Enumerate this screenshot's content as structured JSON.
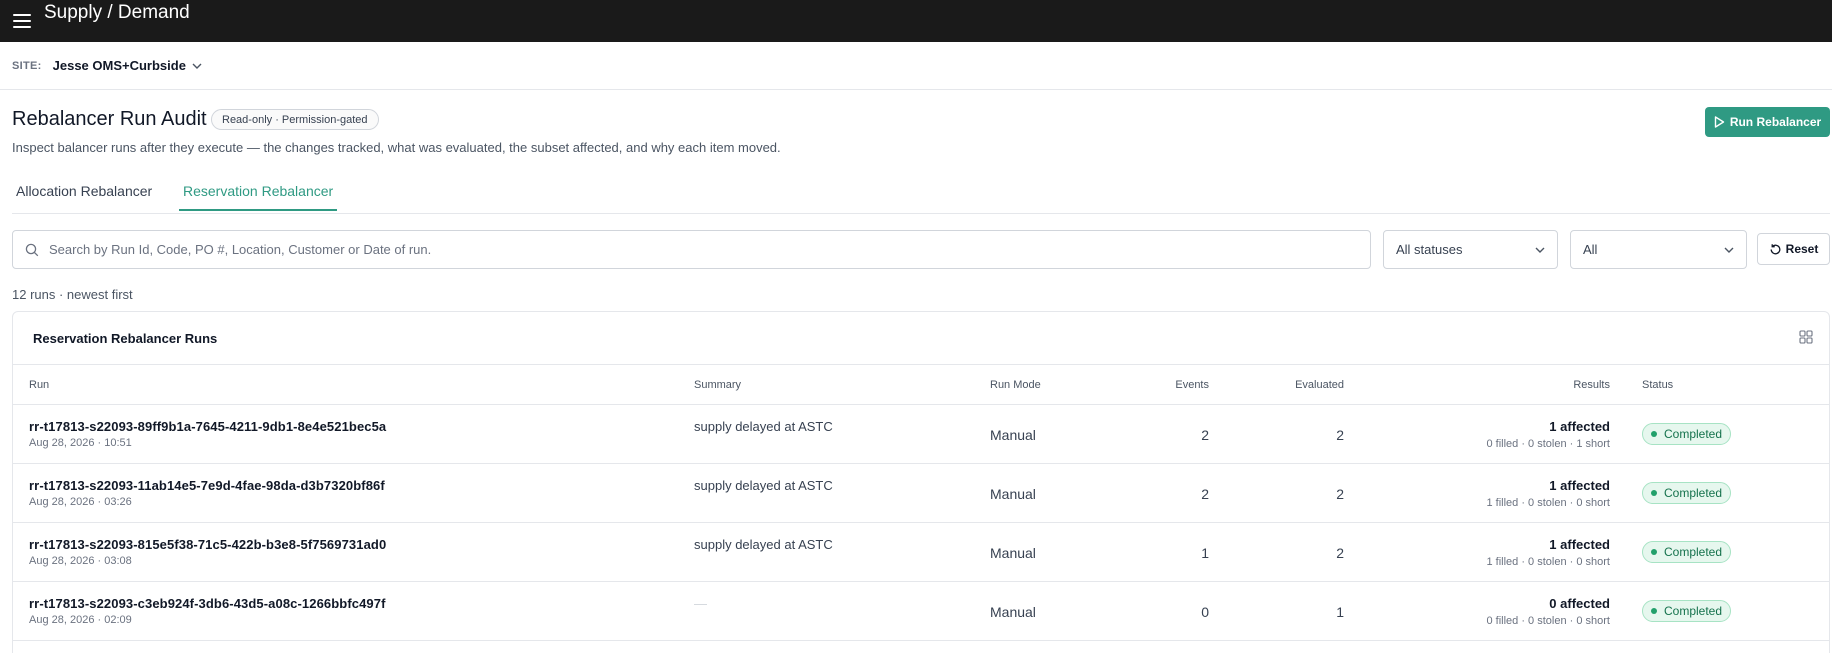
{
  "header": {
    "title": "Supply / Demand",
    "menu_icon": "hamburger-icon"
  },
  "site": {
    "label": "SITE:",
    "value": "Jesse OMS+Curbside"
  },
  "page": {
    "title": "Rebalancer Run Audit",
    "badge": "Read-only · Permission-gated",
    "description": "Inspect balancer runs after they execute — the changes tracked, what was evaluated, the subset affected, and why each item moved.",
    "run_button": "Run Rebalancer"
  },
  "tabs": [
    {
      "label": "Allocation Rebalancer",
      "active": false
    },
    {
      "label": "Reservation Rebalancer",
      "active": true
    }
  ],
  "filters": {
    "search_placeholder": "Search by Run Id, Code, PO #, Location, Customer or Date of run.",
    "status_value": "All statuses",
    "type_value": "All",
    "reset_label": "Reset"
  },
  "runs_count": "12 runs · newest first",
  "table": {
    "title": "Reservation Rebalancer Runs",
    "columns": {
      "run": "Run",
      "summary": "Summary",
      "mode": "Run Mode",
      "events": "Events",
      "evaluated": "Evaluated",
      "results": "Results",
      "status": "Status"
    },
    "rows": [
      {
        "id": "rr-t17813-s22093-89ff9b1a-7645-4211-9db1-8e4e521bec5a",
        "date": "Aug 28, 2026 · 10:51",
        "summary": "supply delayed at ASTC",
        "mode": "Manual",
        "events": "2",
        "evaluated": "2",
        "results_main": "1 affected",
        "results_sub": "0 filled · 0 stolen · 1 short",
        "status": "Completed"
      },
      {
        "id": "rr-t17813-s22093-11ab14e5-7e9d-4fae-98da-d3b7320bf86f",
        "date": "Aug 28, 2026 · 03:26",
        "summary": "supply delayed at ASTC",
        "mode": "Manual",
        "events": "2",
        "evaluated": "2",
        "results_main": "1 affected",
        "results_sub": "1 filled · 0 stolen · 0 short",
        "status": "Completed"
      },
      {
        "id": "rr-t17813-s22093-815e5f38-71c5-422b-b3e8-5f7569731ad0",
        "date": "Aug 28, 2026 · 03:08",
        "summary": "supply delayed at ASTC",
        "mode": "Manual",
        "events": "1",
        "evaluated": "2",
        "results_main": "1 affected",
        "results_sub": "1 filled · 0 stolen · 0 short",
        "status": "Completed"
      },
      {
        "id": "rr-t17813-s22093-c3eb924f-3db6-43d5-a08c-1266bbfc497f",
        "date": "Aug 28, 2026 · 02:09",
        "summary": "—",
        "mode": "Manual",
        "events": "0",
        "evaluated": "1",
        "results_main": "0 affected",
        "results_sub": "0 filled · 0 stolen · 0 short",
        "status": "Completed"
      }
    ]
  },
  "colors": {
    "accent": "#2f9a83",
    "topbar": "#1a1a1a",
    "status_completed": "#22a06b"
  }
}
